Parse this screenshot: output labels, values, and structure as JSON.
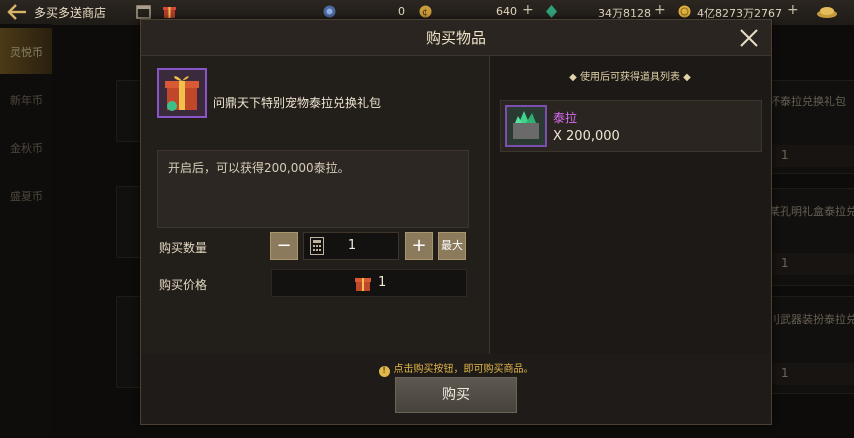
{
  "topbar": {
    "title": "多买多送商店",
    "currency1_value": "0",
    "currency2_value": "640",
    "currency3_value": "34万8128",
    "currency4_value": "4亿8273万2767",
    "plus": "+"
  },
  "nav": {
    "items": [
      {
        "label": "灵悦币"
      },
      {
        "label": "新年币"
      },
      {
        "label": "金秋币"
      },
      {
        "label": "盛夏币"
      }
    ]
  },
  "background_items": [
    {
      "name": "坏泰拉兑换礼包",
      "price": "1"
    },
    {
      "name": "某孔明礼盒泰拉兑",
      "price": "1"
    },
    {
      "name": "刂武器装扮泰拉兑",
      "price": "1"
    }
  ],
  "dialog": {
    "title": "购买物品",
    "item_name": "问鼎天下特别宠物泰拉兑换礼包",
    "description": "开启后，可以获得200,000泰拉。",
    "qty_label": "购买数量",
    "minus": "−",
    "qty_value": "1",
    "plus": "+",
    "max_label": "最大",
    "price_label": "购买价格",
    "price_value": "1",
    "list_title": "◆  使用后可获得道具列表  ◆",
    "reward_name": "泰拉",
    "reward_qty": "X 200,000",
    "hint": "点击购买按钮，即可购买商品。",
    "hint_icon": "!",
    "buy_label": "购买"
  }
}
